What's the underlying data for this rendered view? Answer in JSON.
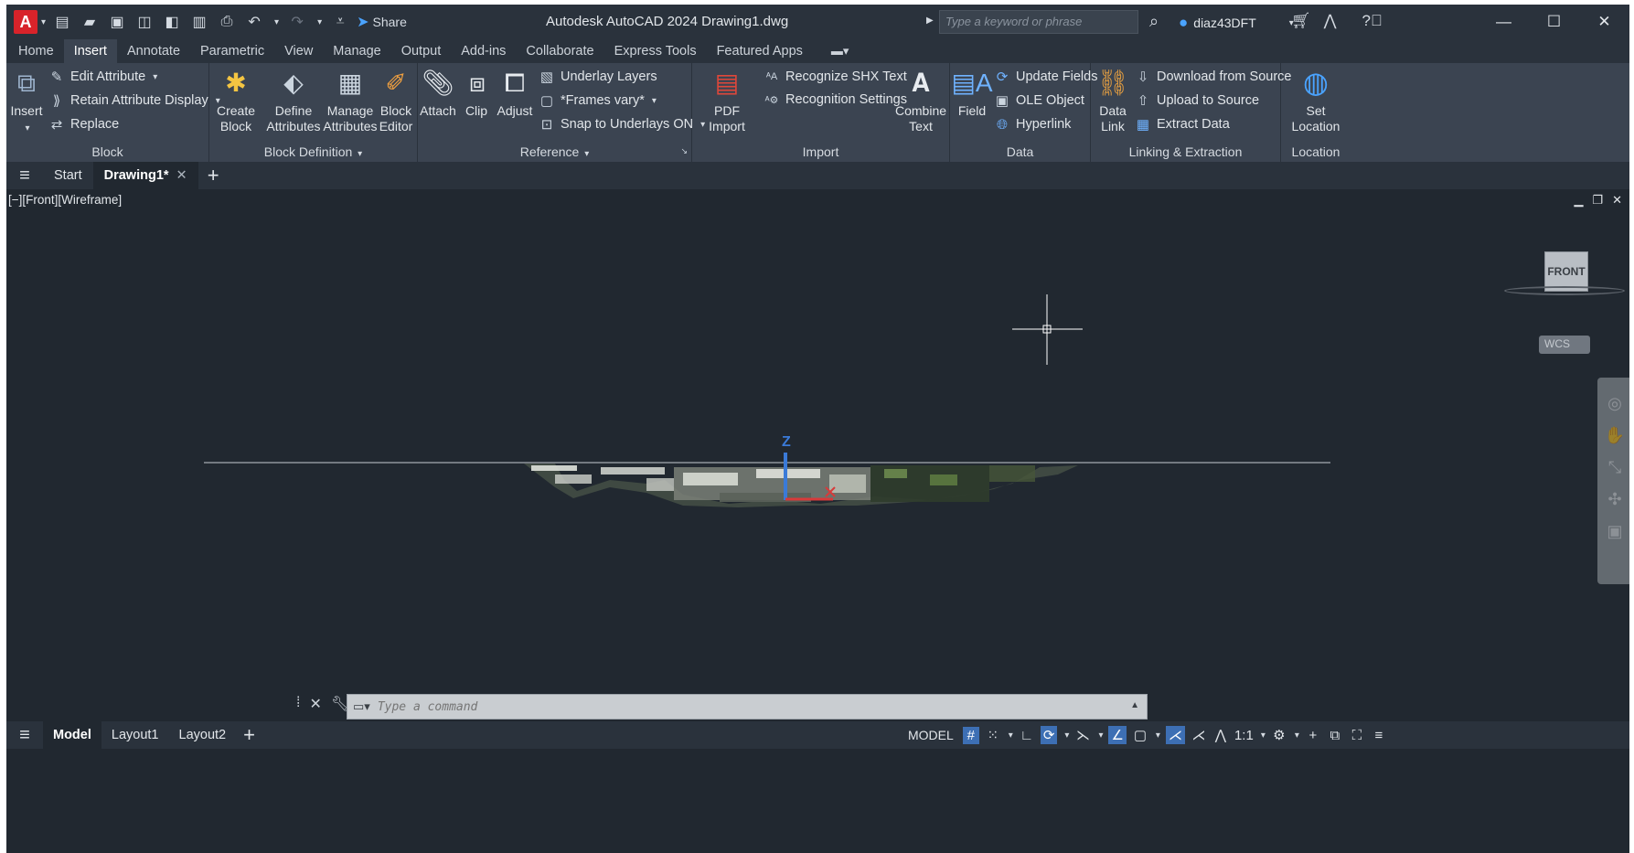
{
  "window": {
    "title": "Autodesk AutoCAD 2024   Drawing1.dwg",
    "logo_letter": "A",
    "share_label": "Share",
    "search_placeholder": "Type a keyword or phrase",
    "username": "diaz43DFT"
  },
  "ribbon_tabs": [
    "Home",
    "Insert",
    "Annotate",
    "Parametric",
    "View",
    "Manage",
    "Output",
    "Add-ins",
    "Collaborate",
    "Express Tools",
    "Featured Apps"
  ],
  "active_ribbon_tab": "Insert",
  "panels": {
    "block": {
      "title": "Block",
      "insert_label": "Insert",
      "edit_attribute": "Edit Attribute",
      "retain_attribute_display": "Retain Attribute Display",
      "replace": "Replace"
    },
    "block_definition": {
      "title": "Block Definition",
      "create_block": "Create Block",
      "define_attributes": "Define Attributes",
      "manage_attributes": "Manage Attributes",
      "block_editor": "Block Editor"
    },
    "reference": {
      "title": "Reference",
      "attach": "Attach",
      "clip": "Clip",
      "adjust": "Adjust",
      "underlay_layers": "Underlay Layers",
      "frames_vary": "*Frames vary*",
      "snap_to_underlays": "Snap to Underlays ON"
    },
    "import": {
      "title": "Import",
      "pdf_import": "PDF Import",
      "recognize_shx": "Recognize SHX Text",
      "recognition_settings": "Recognition Settings",
      "combine_text": "Combine Text"
    },
    "data": {
      "title": "Data",
      "field": "Field",
      "update_fields": "Update Fields",
      "ole_object": "OLE Object",
      "hyperlink": "Hyperlink"
    },
    "linking": {
      "title": "Linking & Extraction",
      "data_link": "Data Link",
      "download_from_source": "Download from Source",
      "upload_to_source": "Upload to Source",
      "extract_data": "Extract  Data"
    },
    "location": {
      "title": "Location",
      "set_location": "Set Location"
    }
  },
  "file_tabs": {
    "start": "Start",
    "active": "Drawing1*"
  },
  "viewport": {
    "label": "[−][Front][Wireframe]",
    "viewcube_face": "FRONT",
    "wcs": "WCS",
    "ucs_axis_label": "Z"
  },
  "command_line": {
    "placeholder": "Type a command"
  },
  "layout_tabs": [
    "Model",
    "Layout1",
    "Layout2"
  ],
  "status": {
    "model": "MODEL",
    "scale": "1:1"
  },
  "colors": {
    "accent": "#3d6fb4",
    "brand": "#d8232a",
    "background": "#212830"
  }
}
